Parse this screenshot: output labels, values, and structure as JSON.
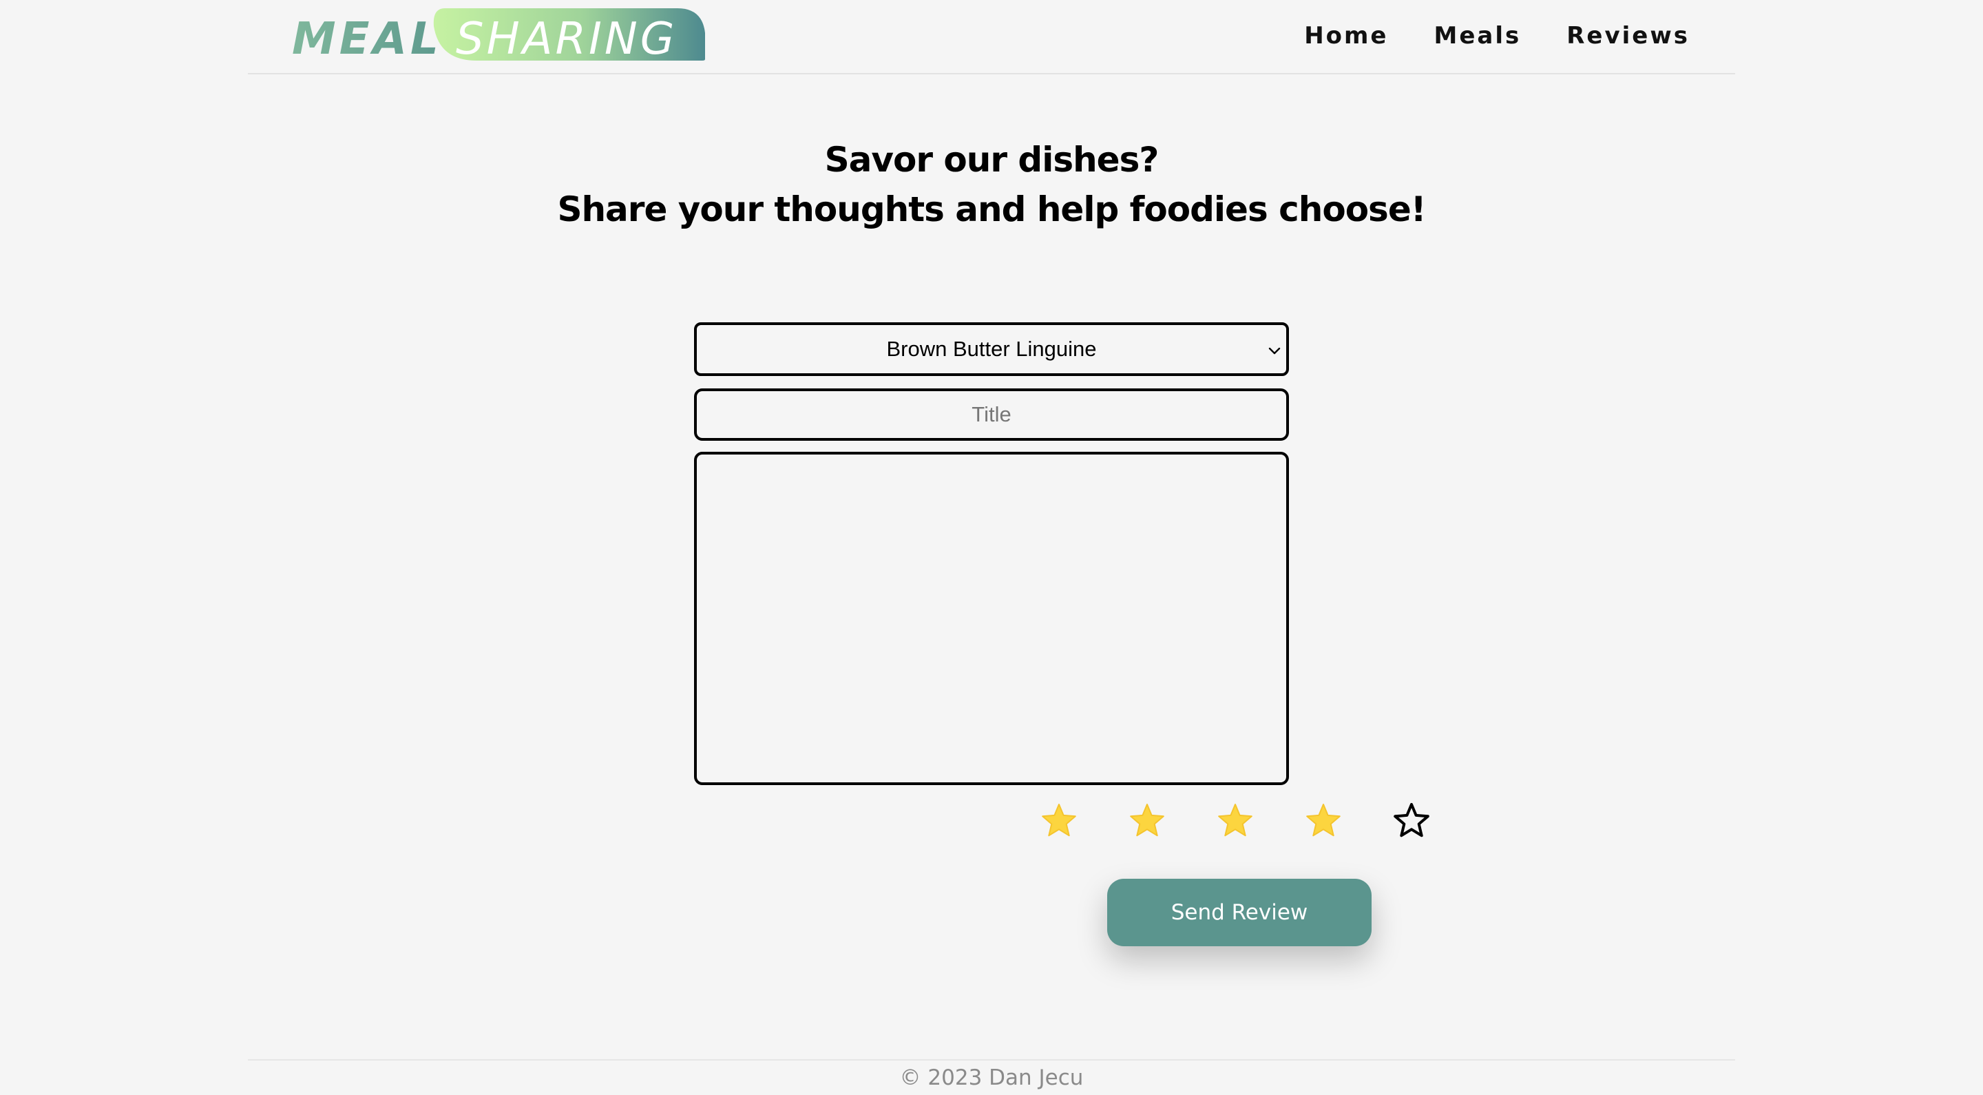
{
  "header": {
    "logo": {
      "word1": "MEAL",
      "word2": "SHARING"
    },
    "nav": [
      "Home",
      "Meals",
      "Reviews"
    ]
  },
  "heading": {
    "line1": "Savor our dishes?",
    "line2": "Share your thoughts and help foodies choose!"
  },
  "form": {
    "meal_select": {
      "selected": "Brown Butter Linguine",
      "icon": "chevron-down-icon"
    },
    "title_placeholder": "Title",
    "description_value": "",
    "rating": {
      "value": 4,
      "max": 5,
      "filled_color": "#fcd53f",
      "empty_color": "#000000"
    },
    "submit_label": "Send Review"
  },
  "footer": {
    "copyright": "© 2023 Dan Jecu"
  },
  "colors": {
    "background": "#f5f5f5",
    "accent": "#5b958e",
    "logo_gradient": [
      "#c6f2a2",
      "#4e8a8f"
    ]
  }
}
